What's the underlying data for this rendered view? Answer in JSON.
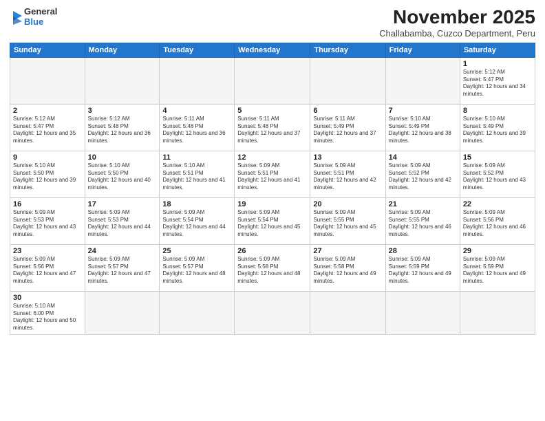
{
  "logo": {
    "line1": "General",
    "line2": "Blue"
  },
  "header": {
    "title": "November 2025",
    "subtitle": "Challabamba, Cuzco Department, Peru"
  },
  "days_of_week": [
    "Sunday",
    "Monday",
    "Tuesday",
    "Wednesday",
    "Thursday",
    "Friday",
    "Saturday"
  ],
  "weeks": [
    [
      {
        "day": "",
        "empty": true
      },
      {
        "day": "",
        "empty": true
      },
      {
        "day": "",
        "empty": true
      },
      {
        "day": "",
        "empty": true
      },
      {
        "day": "",
        "empty": true
      },
      {
        "day": "",
        "empty": true
      },
      {
        "day": "1",
        "sunrise": "5:12 AM",
        "sunset": "5:47 PM",
        "daylight": "12 hours and 34 minutes."
      }
    ],
    [
      {
        "day": "2",
        "sunrise": "5:12 AM",
        "sunset": "5:47 PM",
        "daylight": "12 hours and 35 minutes."
      },
      {
        "day": "3",
        "sunrise": "5:12 AM",
        "sunset": "5:48 PM",
        "daylight": "12 hours and 36 minutes."
      },
      {
        "day": "4",
        "sunrise": "5:11 AM",
        "sunset": "5:48 PM",
        "daylight": "12 hours and 36 minutes."
      },
      {
        "day": "5",
        "sunrise": "5:11 AM",
        "sunset": "5:48 PM",
        "daylight": "12 hours and 37 minutes."
      },
      {
        "day": "6",
        "sunrise": "5:11 AM",
        "sunset": "5:49 PM",
        "daylight": "12 hours and 37 minutes."
      },
      {
        "day": "7",
        "sunrise": "5:10 AM",
        "sunset": "5:49 PM",
        "daylight": "12 hours and 38 minutes."
      },
      {
        "day": "8",
        "sunrise": "5:10 AM",
        "sunset": "5:49 PM",
        "daylight": "12 hours and 39 minutes."
      }
    ],
    [
      {
        "day": "9",
        "sunrise": "5:10 AM",
        "sunset": "5:50 PM",
        "daylight": "12 hours and 39 minutes."
      },
      {
        "day": "10",
        "sunrise": "5:10 AM",
        "sunset": "5:50 PM",
        "daylight": "12 hours and 40 minutes."
      },
      {
        "day": "11",
        "sunrise": "5:10 AM",
        "sunset": "5:51 PM",
        "daylight": "12 hours and 41 minutes."
      },
      {
        "day": "12",
        "sunrise": "5:09 AM",
        "sunset": "5:51 PM",
        "daylight": "12 hours and 41 minutes."
      },
      {
        "day": "13",
        "sunrise": "5:09 AM",
        "sunset": "5:51 PM",
        "daylight": "12 hours and 42 minutes."
      },
      {
        "day": "14",
        "sunrise": "5:09 AM",
        "sunset": "5:52 PM",
        "daylight": "12 hours and 42 minutes."
      },
      {
        "day": "15",
        "sunrise": "5:09 AM",
        "sunset": "5:52 PM",
        "daylight": "12 hours and 43 minutes."
      }
    ],
    [
      {
        "day": "16",
        "sunrise": "5:09 AM",
        "sunset": "5:53 PM",
        "daylight": "12 hours and 43 minutes."
      },
      {
        "day": "17",
        "sunrise": "5:09 AM",
        "sunset": "5:53 PM",
        "daylight": "12 hours and 44 minutes."
      },
      {
        "day": "18",
        "sunrise": "5:09 AM",
        "sunset": "5:54 PM",
        "daylight": "12 hours and 44 minutes."
      },
      {
        "day": "19",
        "sunrise": "5:09 AM",
        "sunset": "5:54 PM",
        "daylight": "12 hours and 45 minutes."
      },
      {
        "day": "20",
        "sunrise": "5:09 AM",
        "sunset": "5:55 PM",
        "daylight": "12 hours and 45 minutes."
      },
      {
        "day": "21",
        "sunrise": "5:09 AM",
        "sunset": "5:55 PM",
        "daylight": "12 hours and 46 minutes."
      },
      {
        "day": "22",
        "sunrise": "5:09 AM",
        "sunset": "5:56 PM",
        "daylight": "12 hours and 46 minutes."
      }
    ],
    [
      {
        "day": "23",
        "sunrise": "5:09 AM",
        "sunset": "5:56 PM",
        "daylight": "12 hours and 47 minutes."
      },
      {
        "day": "24",
        "sunrise": "5:09 AM",
        "sunset": "5:57 PM",
        "daylight": "12 hours and 47 minutes."
      },
      {
        "day": "25",
        "sunrise": "5:09 AM",
        "sunset": "5:57 PM",
        "daylight": "12 hours and 48 minutes."
      },
      {
        "day": "26",
        "sunrise": "5:09 AM",
        "sunset": "5:58 PM",
        "daylight": "12 hours and 48 minutes."
      },
      {
        "day": "27",
        "sunrise": "5:09 AM",
        "sunset": "5:58 PM",
        "daylight": "12 hours and 49 minutes."
      },
      {
        "day": "28",
        "sunrise": "5:09 AM",
        "sunset": "5:59 PM",
        "daylight": "12 hours and 49 minutes."
      },
      {
        "day": "29",
        "sunrise": "5:09 AM",
        "sunset": "5:59 PM",
        "daylight": "12 hours and 49 minutes."
      }
    ],
    [
      {
        "day": "30",
        "sunrise": "5:10 AM",
        "sunset": "6:00 PM",
        "daylight": "12 hours and 50 minutes."
      },
      {
        "day": "",
        "empty": true
      },
      {
        "day": "",
        "empty": true
      },
      {
        "day": "",
        "empty": true
      },
      {
        "day": "",
        "empty": true
      },
      {
        "day": "",
        "empty": true
      },
      {
        "day": "",
        "empty": true
      }
    ]
  ],
  "labels": {
    "sunrise": "Sunrise:",
    "sunset": "Sunset:",
    "daylight": "Daylight:"
  }
}
